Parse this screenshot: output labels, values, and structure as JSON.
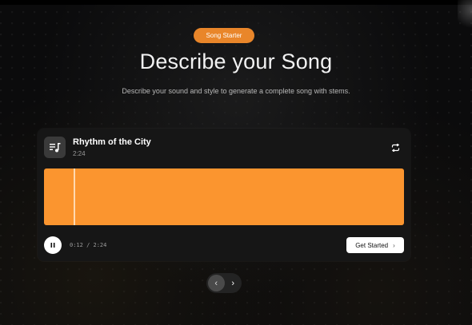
{
  "badge": {
    "label": "Song Starter"
  },
  "hero": {
    "title": "Describe your Song",
    "subtitle": "Describe your sound and style to generate a complete song with stems."
  },
  "player": {
    "track_title": "Rhythm of the City",
    "track_duration": "2:24",
    "time_display": "0:12 / 2:24",
    "progress_fraction": 0.083,
    "waveform_color": "#fb952f",
    "accent_color": "#e9862a",
    "icons": {
      "track": "playlist-music-icon",
      "loop": "repeat-icon",
      "pause": "pause-icon",
      "cta_chevron": "chevron-right-icon"
    },
    "cta_label": "Get Started",
    "cta_chevron": "›"
  },
  "pager": {
    "prev_glyph": "‹",
    "next_glyph": "›"
  }
}
